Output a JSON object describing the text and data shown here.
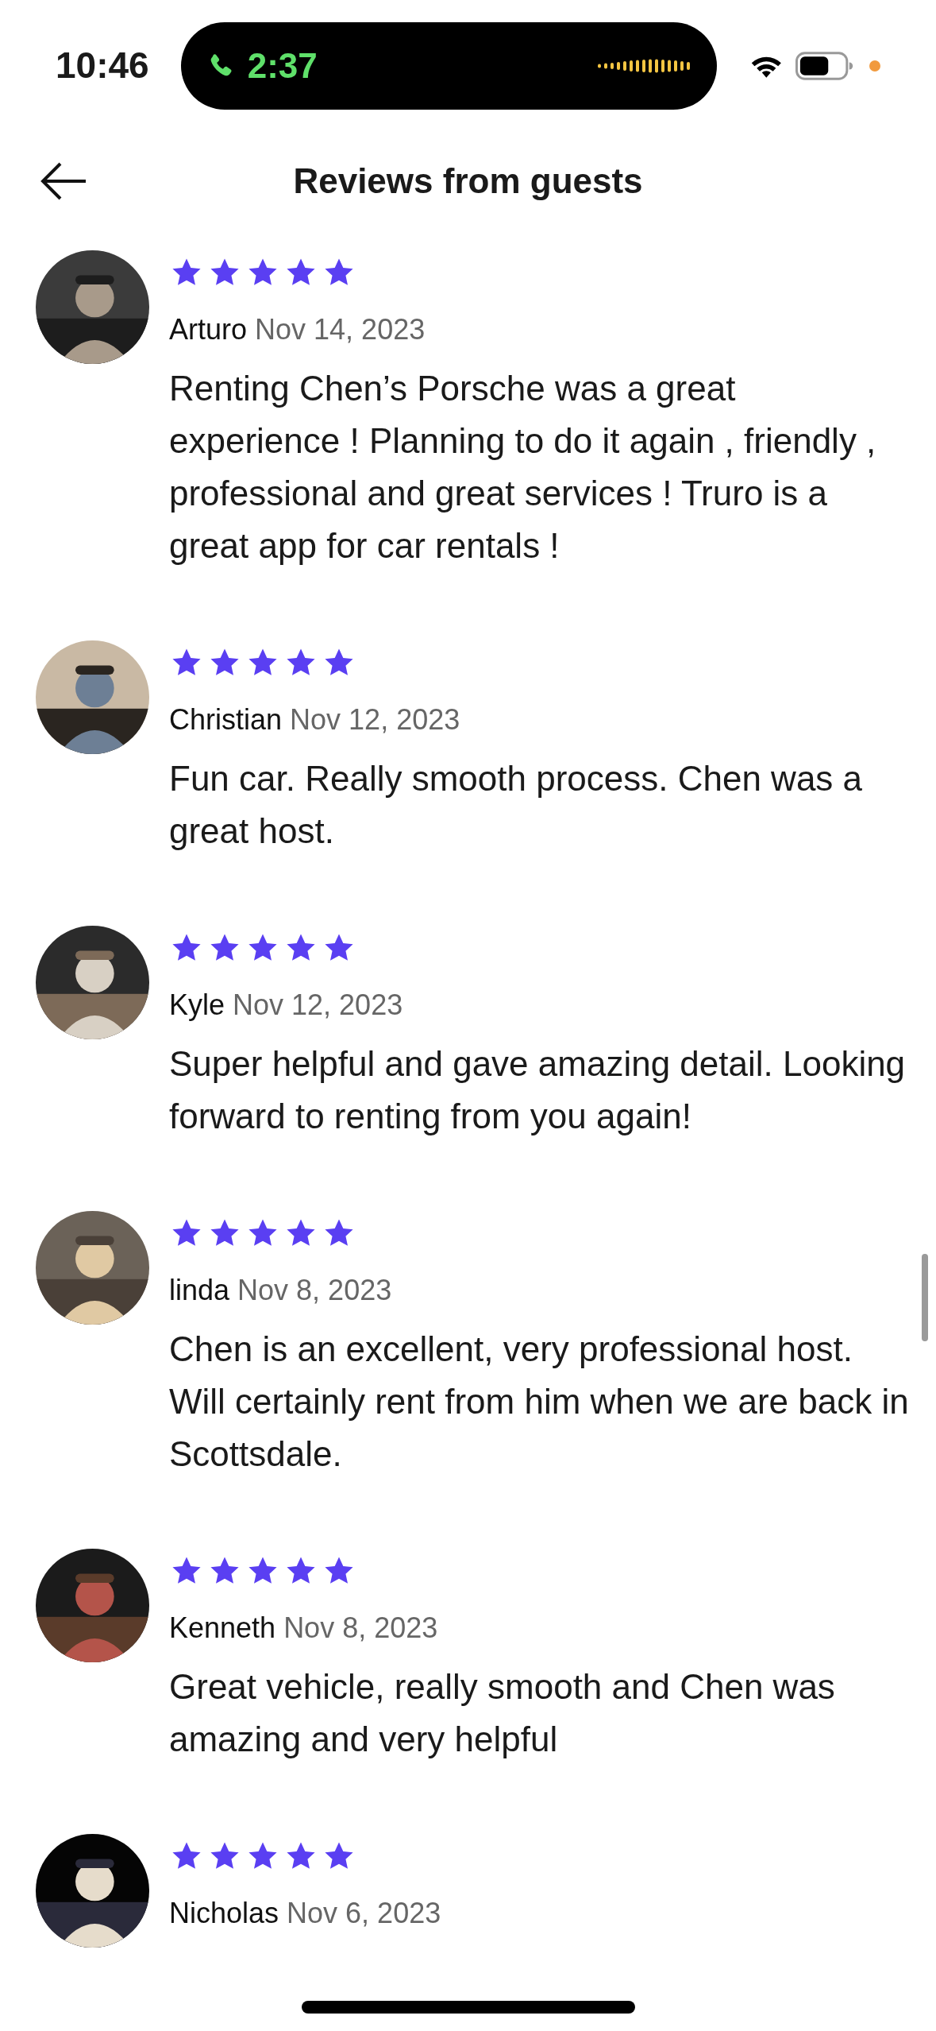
{
  "status_bar": {
    "time": "10:46",
    "call_timer": "2:37"
  },
  "header": {
    "title": "Reviews from guests"
  },
  "reviews": [
    {
      "name": "Arturo",
      "date": "Nov 14, 2023",
      "stars": 5,
      "text": "Renting Chen’s Porsche was a great experience ! Planning to do it again , friendly , professional and great services ! Truro is a great app for car rentals !"
    },
    {
      "name": "Christian",
      "date": "Nov 12, 2023",
      "stars": 5,
      "text": "Fun car. Really smooth process. Chen was a great host."
    },
    {
      "name": "Kyle",
      "date": "Nov 12, 2023",
      "stars": 5,
      "text": "Super helpful and gave amazing detail. Looking forward to renting from you again!"
    },
    {
      "name": "linda",
      "date": "Nov 8, 2023",
      "stars": 5,
      "text": "Chen is an excellent, very professional host.  Will certainly rent from him when we are back in Scottsdale."
    },
    {
      "name": "Kenneth",
      "date": "Nov 8, 2023",
      "stars": 5,
      "text": "Great vehicle, really smooth and Chen was amazing and very helpful"
    },
    {
      "name": "Nicholas",
      "date": "Nov 6, 2023",
      "stars": 5
    }
  ]
}
